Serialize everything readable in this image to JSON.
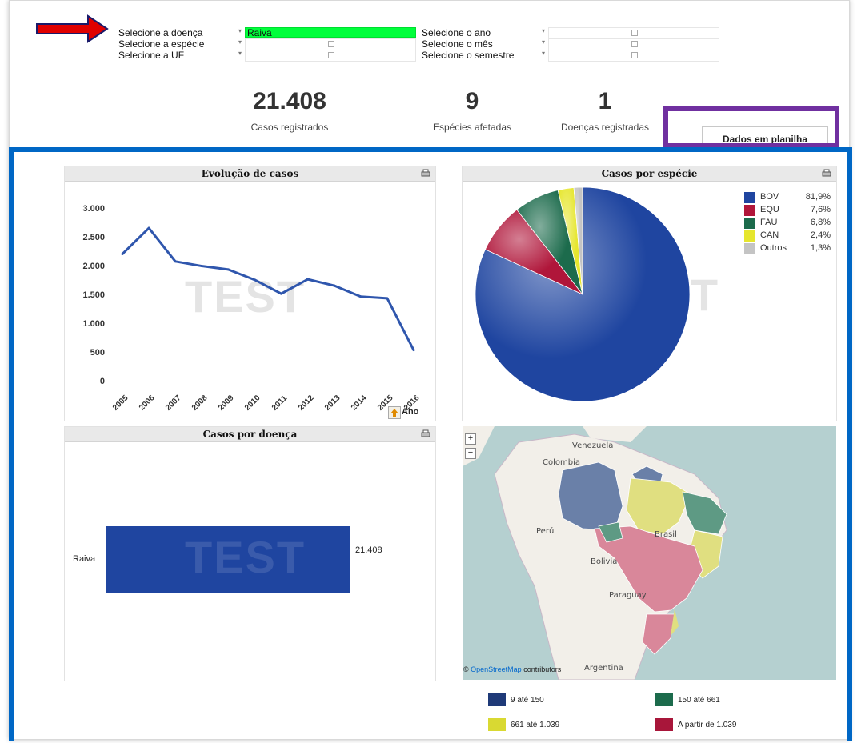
{
  "filters": {
    "doenca_label": "Selecione a doença",
    "doenca_value": "Raiva",
    "especie_label": "Selecione a espécie",
    "uf_label": "Selecione a UF",
    "ano_label": "Selecione o ano",
    "mes_label": "Selecione o mês",
    "semestre_label": "Selecione o semestre"
  },
  "kpis": [
    {
      "value": "21.408",
      "label": "Casos registrados"
    },
    {
      "value": "9",
      "label": "Espécies afetadas"
    },
    {
      "value": "1",
      "label": "Doenças registradas"
    }
  ],
  "sheet_button": "Dados em planilha",
  "watermark": "TEST",
  "annotations": {
    "red_arrow": "#e00000",
    "purple_box": "#7030a0",
    "blue_box": "#0067c5"
  },
  "panels": {
    "evolucao_title": "Evolução de casos",
    "especie_title": "Casos por espécie",
    "doenca_title": "Casos por doença",
    "ano_button": "Ano"
  },
  "chart_data": [
    {
      "type": "line",
      "title": "Evolução de casos",
      "xlabel": "Ano",
      "x": [
        "2005",
        "2006",
        "2007",
        "2008",
        "2009",
        "2010",
        "2011",
        "2012",
        "2013",
        "2014",
        "2015",
        "2016"
      ],
      "y": [
        2230,
        2680,
        2100,
        2020,
        1960,
        1780,
        1540,
        1790,
        1680,
        1490,
        1460,
        560
      ],
      "yticks": [
        "3.000",
        "2.500",
        "2.000",
        "1.500",
        "1.000",
        "500",
        "0"
      ],
      "ylim": [
        0,
        3000
      ],
      "color": "#2f56ad"
    },
    {
      "type": "pie",
      "title": "Casos por espécie",
      "labels": [
        "BOV",
        "EQU",
        "FAU",
        "CAN",
        "Outros"
      ],
      "values": [
        81.9,
        7.6,
        6.8,
        2.4,
        1.3
      ],
      "value_labels": [
        "81,9%",
        "7,6%",
        "6,8%",
        "2,4%",
        "1,3%"
      ],
      "colors": [
        "#1f45a0",
        "#b0163a",
        "#1c6b4c",
        "#e6e62e",
        "#c4c4c4"
      ],
      "legend": "top-right"
    },
    {
      "type": "bar",
      "title": "Casos por doença",
      "categories": [
        "Raiva"
      ],
      "values": [
        21408
      ],
      "value_labels": [
        "21.408"
      ],
      "color": "#1f45a0"
    }
  ],
  "map": {
    "zoom_in": "+",
    "zoom_out": "−",
    "attribution_link": "OpenStreetMap",
    "attribution_rest": "contributors",
    "attribution_symbol": "©",
    "labels": [
      "Venezuela",
      "Colombia",
      "Perú",
      "Brasil",
      "Bolivia",
      "Paraguay",
      "Argentina"
    ],
    "legend": [
      {
        "label": "9 até 150",
        "color": "#1f3a78"
      },
      {
        "label": "150 até 661",
        "color": "#1c6b4c"
      },
      {
        "label": "661 até 1.039",
        "color": "#d9d932"
      },
      {
        "label": "A partir de 1.039",
        "color": "#a8163a"
      }
    ]
  }
}
